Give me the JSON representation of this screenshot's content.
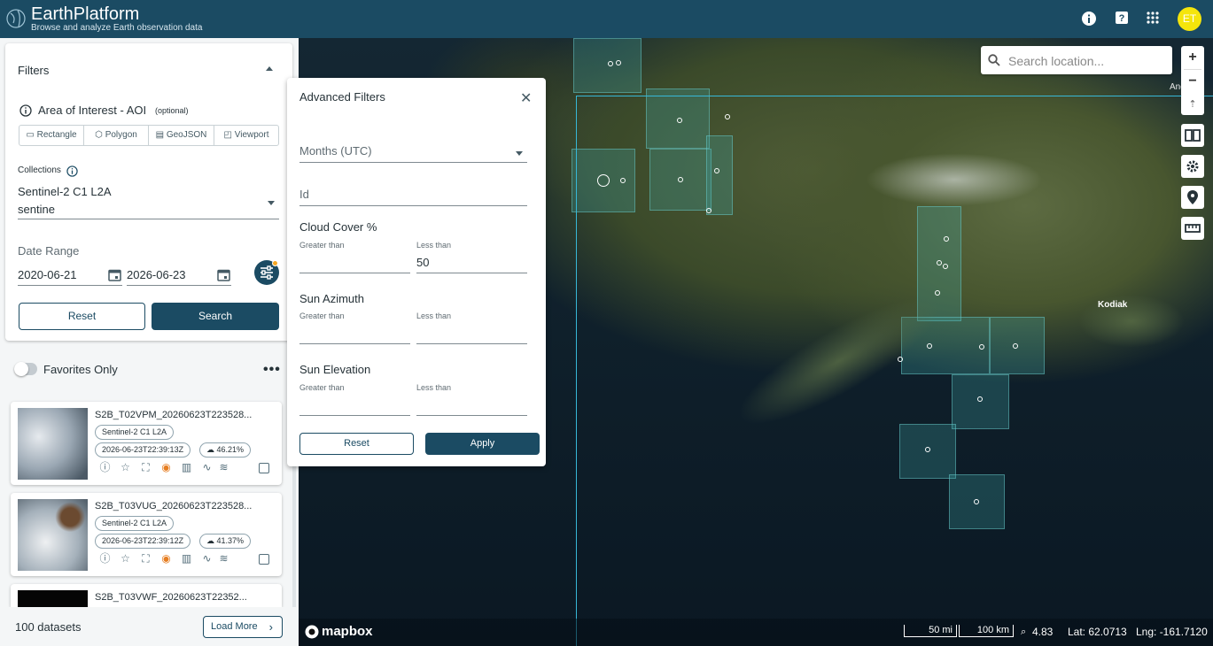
{
  "header": {
    "title": "EarthPlatform",
    "subtitle": "Browse and analyze Earth observation data",
    "avatar": "ET",
    "icons": [
      "info-icon",
      "help-icon",
      "apps-icon"
    ]
  },
  "filters": {
    "title": "Filters",
    "aoi_label": "Area of Interest - AOI",
    "aoi_optional": "(optional)",
    "aoi_buttons": [
      "Rectangle",
      "Polygon",
      "GeoJSON",
      "Viewport"
    ],
    "collections_label": "Collections",
    "collection_value": "Sentinel-2 C1 L2A",
    "collection_query": "sentine",
    "date_label": "Date Range",
    "date_start": "2020-06-21",
    "date_end": "2026-06-23",
    "reset": "Reset",
    "search": "Search"
  },
  "favorites_label": "Favorites Only",
  "results": [
    {
      "title": "S2B_T02VPM_20260623T223528...",
      "collection": "Sentinel-2 C1 L2A",
      "datetime": "2026-06-23T22:39:13Z",
      "cloud": "46.21%"
    },
    {
      "title": "S2B_T03VUG_20260623T223528...",
      "collection": "Sentinel-2 C1 L2A",
      "datetime": "2026-06-23T22:39:12Z",
      "cloud": "41.37%"
    },
    {
      "title": "S2B_T03VWF_20260623T22352..."
    }
  ],
  "footer": {
    "count": "100 datasets",
    "load_more": "Load More"
  },
  "advanced": {
    "title": "Advanced Filters",
    "months_placeholder": "Months (UTC)",
    "id_placeholder": "Id",
    "cloud_label": "Cloud Cover %",
    "sun_az_label": "Sun Azimuth",
    "sun_el_label": "Sun Elevation",
    "greater": "Greater than",
    "less": "Less than",
    "cloud_lt": "50",
    "reset": "Reset",
    "apply": "Apply"
  },
  "map": {
    "search_placeholder": "Search location...",
    "place_kodiak": "Kodiak",
    "place_anchorage": "Anc",
    "attribution": "mapbox",
    "scale_mi": "50 mi",
    "scale_km": "100 km",
    "zoom": "4.83",
    "lat": "Lat: 62.0713",
    "lng": "Lng: -161.7120"
  }
}
